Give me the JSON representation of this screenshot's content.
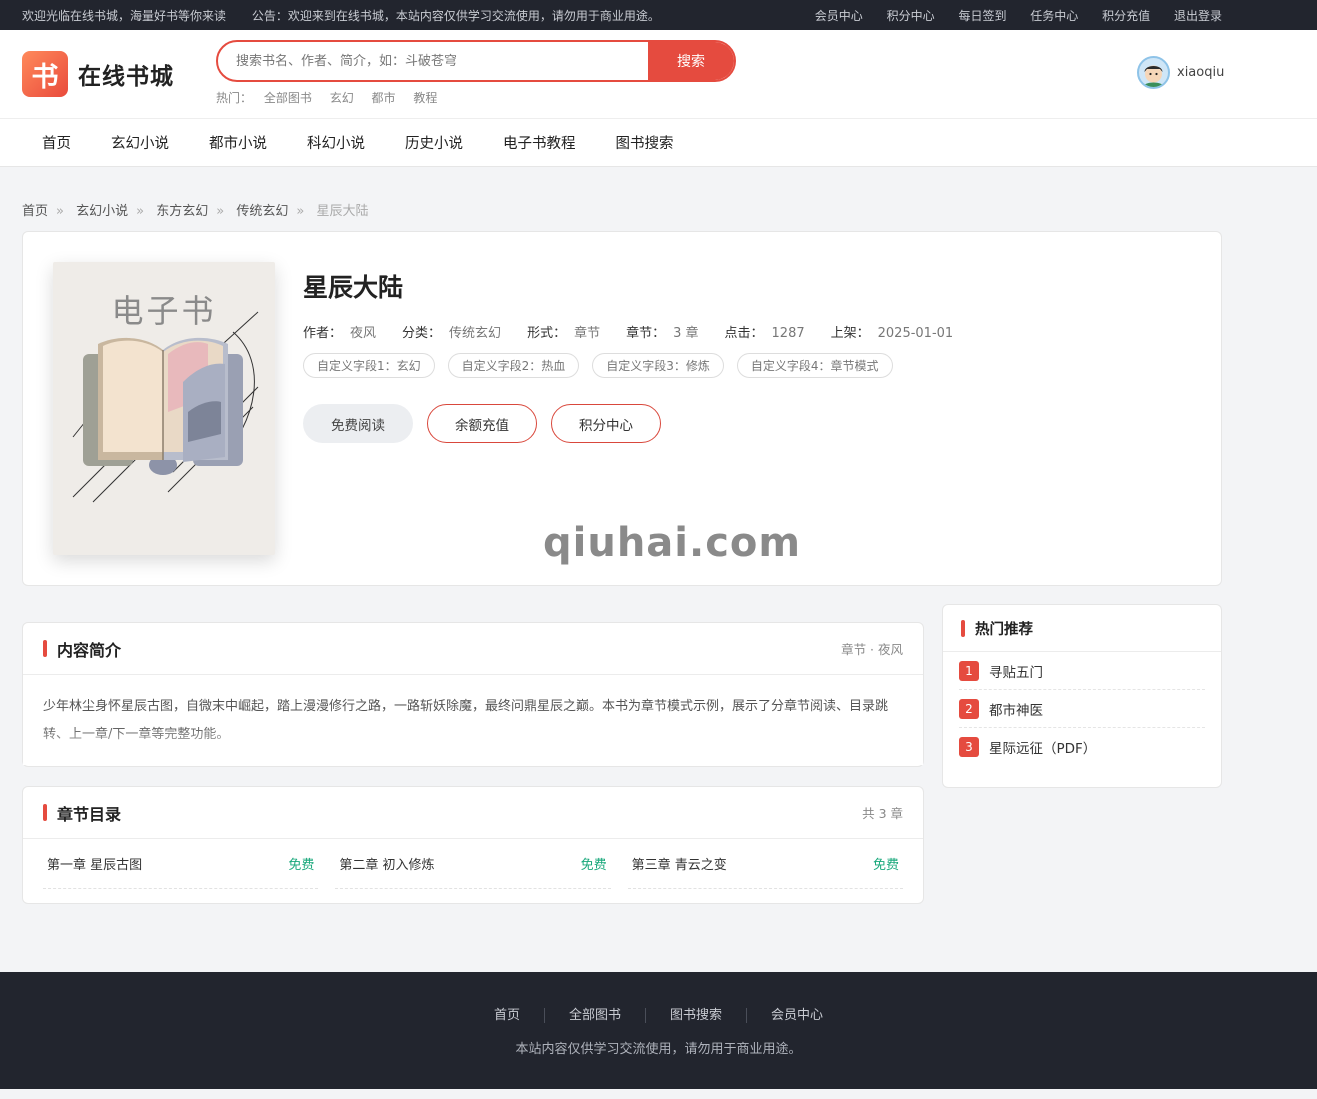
{
  "topbar": {
    "welcome": "欢迎光临在线书城，海量好书等你来读",
    "notice": "公告：欢迎来到在线书城，本站内容仅供学习交流使用，请勿用于商业用途。",
    "links": [
      "会员中心",
      "积分中心",
      "每日签到",
      "任务中心",
      "积分充值",
      "退出登录"
    ]
  },
  "header": {
    "logo_mark": "书",
    "logo_text": "在线书城",
    "search_placeholder": "搜索书名、作者、简介，如：斗破苍穹",
    "search_button": "搜索",
    "hot_label": "热门：",
    "hot_keywords": [
      "全部图书",
      "玄幻",
      "都市",
      "教程"
    ],
    "user_name": "xiaoqiu"
  },
  "nav": [
    "首页",
    "玄幻小说",
    "都市小说",
    "科幻小说",
    "历史小说",
    "电子书教程",
    "图书搜索"
  ],
  "breadcrumb": [
    "首页",
    "玄幻小说",
    "东方玄幻",
    "传统玄幻",
    "星辰大陆"
  ],
  "book": {
    "cover_title": "电子书",
    "title": "星辰大陆",
    "meta": [
      {
        "k": "作者：",
        "v": "夜风"
      },
      {
        "k": "分类：",
        "v": "传统玄幻"
      },
      {
        "k": "形式：",
        "v": "章节"
      },
      {
        "k": "章节：",
        "v": "3 章"
      },
      {
        "k": "点击：",
        "v": "1287"
      },
      {
        "k": "上架：",
        "v": "2025-01-01"
      }
    ],
    "tags": [
      "自定义字段1：玄幻",
      "自定义字段2：热血",
      "自定义字段3：修炼",
      "自定义字段4：章节模式"
    ],
    "actions": {
      "read": "免费阅读",
      "recharge": "余额充值",
      "points": "积分中心"
    },
    "watermark": "qiuhai.com"
  },
  "intro": {
    "title": "内容简介",
    "extra": "章节 · 夜风",
    "text": "少年林尘身怀星辰古图，自微末中崛起，踏上漫漫修行之路，一路斩妖除魔，最终问鼎星辰之巅。本书为章节模式示例，展示了分章节阅读、目录跳转、上一章/下一章等完整功能。"
  },
  "chapters": {
    "title": "章节目录",
    "count": "共 3 章",
    "free_label": "免费",
    "items": [
      "第一章 星辰古图",
      "第二章 初入修炼",
      "第三章 青云之变"
    ]
  },
  "hot": {
    "title": "热门推荐",
    "items": [
      {
        "rank": "1",
        "name": "寻贴五门"
      },
      {
        "rank": "2",
        "name": "都市神医"
      },
      {
        "rank": "3",
        "name": "星际远征（PDF）"
      }
    ]
  },
  "footer": {
    "links": [
      "首页",
      "全部图书",
      "图书搜索",
      "会员中心"
    ],
    "note": "本站内容仅供学习交流使用，请勿用于商业用途。"
  },
  "colors": {
    "accent": "#e54b3f",
    "free": "#18a87b",
    "dark": "#22252e"
  }
}
